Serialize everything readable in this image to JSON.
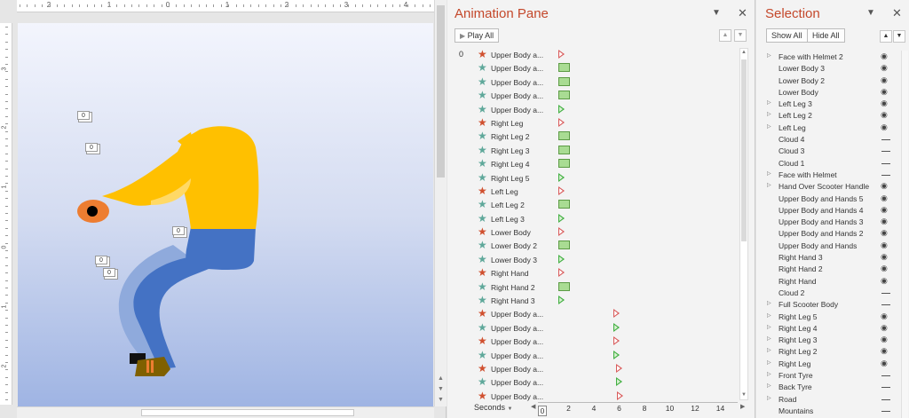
{
  "ruler": {
    "h_labels": [
      "2",
      "1",
      "0",
      "1",
      "2",
      "3",
      "4"
    ],
    "v_labels": [
      "3",
      "2",
      "1",
      "0",
      "1",
      "2"
    ]
  },
  "slide": {
    "colors": {
      "body": "#ffc000",
      "jeans": "#4472c4",
      "jeans_shadow": "#8faadc",
      "face": "#ed7d31",
      "shoe": "#7f6000"
    },
    "tags": [
      "0",
      "0",
      "0",
      "0",
      "0"
    ]
  },
  "animation_pane": {
    "title": "Animation Pane",
    "play_all": "Play All",
    "dropdown_icon": "chevron-down-icon",
    "close_icon": "close-icon",
    "seconds_label": "Seconds",
    "timeline_ticks": [
      "0",
      "2",
      "4",
      "6",
      "8",
      "10",
      "12",
      "14"
    ],
    "items": [
      {
        "idx": "0",
        "label": "Upper Body a...",
        "star": "red",
        "kind": "tri-red",
        "pos": 0.0
      },
      {
        "idx": "",
        "label": "Upper Body a...",
        "star": "green",
        "kind": "bar",
        "pos": 0.0
      },
      {
        "idx": "",
        "label": "Upper Body a...",
        "star": "green",
        "kind": "bar",
        "pos": 0.0
      },
      {
        "idx": "",
        "label": "Upper Body a...",
        "star": "green",
        "kind": "bar",
        "pos": 0.0
      },
      {
        "idx": "",
        "label": "Upper Body a...",
        "star": "green",
        "kind": "tri-green",
        "pos": 0.0
      },
      {
        "idx": "",
        "label": "Right Leg",
        "star": "red",
        "kind": "tri-red",
        "pos": 0.0
      },
      {
        "idx": "",
        "label": "Right Leg 2",
        "star": "green",
        "kind": "bar",
        "pos": 0.0
      },
      {
        "idx": "",
        "label": "Right Leg 3",
        "star": "green",
        "kind": "bar",
        "pos": 0.0
      },
      {
        "idx": "",
        "label": "Right Leg 4",
        "star": "green",
        "kind": "bar",
        "pos": 0.0
      },
      {
        "idx": "",
        "label": "Right Leg 5",
        "star": "green",
        "kind": "tri-green",
        "pos": 0.0
      },
      {
        "idx": "",
        "label": "Left Leg",
        "star": "red",
        "kind": "tri-red",
        "pos": 0.0
      },
      {
        "idx": "",
        "label": "Left Leg 2",
        "star": "green",
        "kind": "bar",
        "pos": 0.0
      },
      {
        "idx": "",
        "label": "Left Leg 3",
        "star": "green",
        "kind": "tri-green",
        "pos": 0.0
      },
      {
        "idx": "",
        "label": "Lower Body",
        "star": "red",
        "kind": "tri-red",
        "pos": 0.0
      },
      {
        "idx": "",
        "label": "Lower Body 2",
        "star": "green",
        "kind": "bar",
        "pos": 0.0
      },
      {
        "idx": "",
        "label": "Lower Body 3",
        "star": "green",
        "kind": "tri-green",
        "pos": 0.0
      },
      {
        "idx": "",
        "label": "Right Hand",
        "star": "red",
        "kind": "tri-red",
        "pos": 0.0
      },
      {
        "idx": "",
        "label": "Right Hand 2",
        "star": "green",
        "kind": "bar",
        "pos": 0.0
      },
      {
        "idx": "",
        "label": "Right Hand 3",
        "star": "green",
        "kind": "tri-green",
        "pos": 0.0
      },
      {
        "idx": "",
        "label": "Upper Body a...",
        "star": "red",
        "kind": "tri-red",
        "pos": 4.3
      },
      {
        "idx": "",
        "label": "Upper Body a...",
        "star": "green",
        "kind": "tri-green",
        "pos": 4.3
      },
      {
        "idx": "",
        "label": "Upper Body a...",
        "star": "red",
        "kind": "tri-red",
        "pos": 4.3
      },
      {
        "idx": "",
        "label": "Upper Body a...",
        "star": "green",
        "kind": "tri-green",
        "pos": 4.3
      },
      {
        "idx": "",
        "label": "Upper Body a...",
        "star": "red",
        "kind": "tri-red",
        "pos": 4.5
      },
      {
        "idx": "",
        "label": "Upper Body a...",
        "star": "green",
        "kind": "tri-green",
        "pos": 4.5
      },
      {
        "idx": "",
        "label": "Upper Body a...",
        "star": "red",
        "kind": "tri-red",
        "pos": 4.6
      }
    ]
  },
  "selection_pane": {
    "title": "Selection",
    "show_all": "Show All",
    "hide_all": "Hide All",
    "items": [
      {
        "label": "Face with Helmet 2",
        "expandable": true,
        "visible": true
      },
      {
        "label": "Lower Body 3",
        "expandable": false,
        "visible": true
      },
      {
        "label": "Lower Body 2",
        "expandable": false,
        "visible": true
      },
      {
        "label": "Lower Body",
        "expandable": false,
        "visible": true
      },
      {
        "label": "Left Leg 3",
        "expandable": true,
        "visible": true
      },
      {
        "label": "Left Leg 2",
        "expandable": true,
        "visible": true
      },
      {
        "label": "Left Leg",
        "expandable": true,
        "visible": true
      },
      {
        "label": "Cloud 4",
        "expandable": false,
        "visible": false
      },
      {
        "label": "Cloud 3",
        "expandable": false,
        "visible": false
      },
      {
        "label": "Cloud 1",
        "expandable": false,
        "visible": false
      },
      {
        "label": "Face with Helmet",
        "expandable": true,
        "visible": false
      },
      {
        "label": "Hand Over Scooter Handle",
        "expandable": true,
        "visible": true
      },
      {
        "label": "Upper Body and Hands 5",
        "expandable": false,
        "visible": true
      },
      {
        "label": "Upper Body and Hands 4",
        "expandable": false,
        "visible": true
      },
      {
        "label": "Upper Body and Hands 3",
        "expandable": false,
        "visible": true
      },
      {
        "label": "Upper Body and Hands 2",
        "expandable": false,
        "visible": true
      },
      {
        "label": "Upper Body and Hands",
        "expandable": false,
        "visible": true
      },
      {
        "label": "Right Hand 3",
        "expandable": false,
        "visible": true
      },
      {
        "label": "Right Hand 2",
        "expandable": false,
        "visible": true
      },
      {
        "label": "Right Hand",
        "expandable": false,
        "visible": true
      },
      {
        "label": "Cloud 2",
        "expandable": false,
        "visible": false
      },
      {
        "label": "Full Scooter Body",
        "expandable": true,
        "visible": false
      },
      {
        "label": "Right Leg 5",
        "expandable": true,
        "visible": true
      },
      {
        "label": "Right Leg 4",
        "expandable": true,
        "visible": true
      },
      {
        "label": "Right Leg 3",
        "expandable": true,
        "visible": true
      },
      {
        "label": "Right Leg 2",
        "expandable": true,
        "visible": true
      },
      {
        "label": "Right Leg",
        "expandable": true,
        "visible": true
      },
      {
        "label": "Front Tyre",
        "expandable": true,
        "visible": false
      },
      {
        "label": "Back Tyre",
        "expandable": true,
        "visible": false
      },
      {
        "label": "Road",
        "expandable": true,
        "visible": false
      },
      {
        "label": "Mountains",
        "expandable": false,
        "visible": false
      }
    ]
  }
}
